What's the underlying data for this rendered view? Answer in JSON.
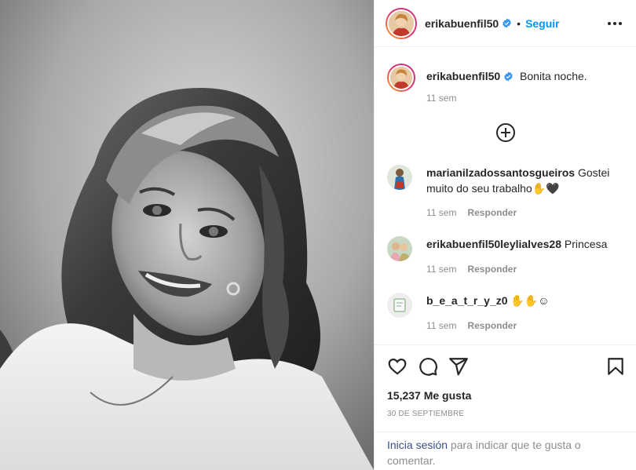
{
  "post": {
    "author": "erikabuenfil50",
    "follow_label": "Seguir",
    "separator": "•"
  },
  "caption": {
    "username": "erikabuenfil50",
    "text": "Bonita noche.",
    "time": "11 sem"
  },
  "comments": [
    {
      "username": "marianilzadossantosgueiros",
      "text": " Gostei muito do seu trabalho✋🖤",
      "time": "11 sem",
      "reply_label": "Responder"
    },
    {
      "username": "erikabuenfil50leylialves28",
      "text": " Princesa",
      "time": "11 sem",
      "reply_label": "Responder"
    },
    {
      "username": "b_e_a_t_r_y_z0",
      "text": " ✋✋☺",
      "time": "11 sem",
      "reply_label": "Responder"
    }
  ],
  "stats": {
    "likes": "15,237 Me gusta",
    "date": "30 DE SEPTIEMBRE"
  },
  "login_prompt": {
    "link_text": "Inicia sesión",
    "rest_text": " para indicar que te gusta o comentar."
  },
  "icons": {
    "like": "heart-icon",
    "comment": "comment-icon",
    "share": "send-icon",
    "save": "bookmark-icon",
    "more": "more-options-icon",
    "load_more": "plus-circle-icon",
    "verified": "verified-badge-icon"
  },
  "colors": {
    "link_blue": "#0095f6",
    "login_link": "#385185",
    "verified": "#3897f0",
    "muted": "#8e8e8e"
  }
}
